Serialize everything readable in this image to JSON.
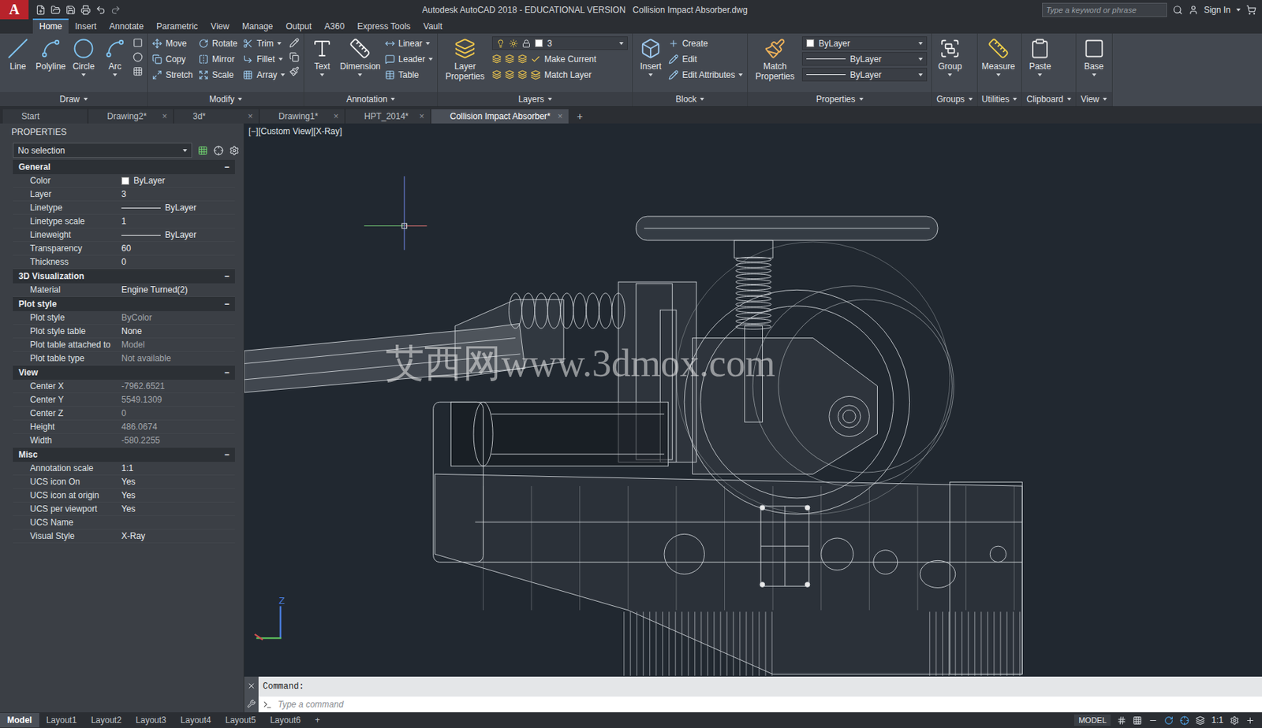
{
  "window": {
    "logo": "A",
    "app_title": "Autodesk AutoCAD 2018 - EDUCATIONAL VERSION",
    "file_name": "Collision Impact Absorber.dwg",
    "search_placeholder": "Type a keyword or phrase",
    "sign_in": "Sign In"
  },
  "ribbon_tabs": [
    {
      "label": "Home",
      "selected": true
    },
    {
      "label": "Insert",
      "selected": false
    },
    {
      "label": "Annotate",
      "selected": false
    },
    {
      "label": "Parametric",
      "selected": false
    },
    {
      "label": "View",
      "selected": false
    },
    {
      "label": "Manage",
      "selected": false
    },
    {
      "label": "Output",
      "selected": false
    },
    {
      "label": "A360",
      "selected": false
    },
    {
      "label": "Express Tools",
      "selected": false
    },
    {
      "label": "Vault",
      "selected": false
    }
  ],
  "ribbon_panels": [
    {
      "title": "Draw",
      "large": [
        {
          "label": "Line",
          "menu": false
        },
        {
          "label": "Polyline",
          "menu": false
        },
        {
          "label": "Circle",
          "menu": true
        },
        {
          "label": "Arc",
          "menu": true
        }
      ],
      "small": [],
      "dropdowns": []
    },
    {
      "title": "Modify",
      "large": [],
      "small": [
        {
          "label": "Move",
          "menu": false
        },
        {
          "label": "Rotate",
          "menu": false
        },
        {
          "label": "Trim",
          "menu": true
        },
        {
          "label": "Copy",
          "menu": false
        },
        {
          "label": "Mirror",
          "menu": false
        },
        {
          "label": "Fillet",
          "menu": true
        },
        {
          "label": "Stretch",
          "menu": false
        },
        {
          "label": "Scale",
          "menu": false
        },
        {
          "label": "Array",
          "menu": true
        }
      ],
      "dropdowns": []
    },
    {
      "title": "Annotation",
      "large": [
        {
          "label": "Text",
          "menu": true
        },
        {
          "label": "Dimension",
          "menu": true
        }
      ],
      "small": [
        {
          "label": "Linear",
          "menu": true
        },
        {
          "label": "Leader",
          "menu": true
        },
        {
          "label": "Table",
          "menu": false
        }
      ],
      "dropdowns": []
    },
    {
      "title": "Layers",
      "large": [
        {
          "label": "Layer Properties",
          "menu": false
        }
      ],
      "small": [
        {
          "label": "Make Current",
          "menu": false
        },
        {
          "label": "Match Layer",
          "menu": false
        }
      ],
      "dropdowns": [
        {
          "value": "3",
          "kind": "layer"
        }
      ]
    },
    {
      "title": "Block",
      "large": [
        {
          "label": "Insert",
          "menu": true
        }
      ],
      "small": [
        {
          "label": "Create",
          "menu": false
        },
        {
          "label": "Edit",
          "menu": false
        },
        {
          "label": "Edit Attributes",
          "menu": true
        }
      ],
      "dropdowns": []
    },
    {
      "title": "Properties",
      "large": [
        {
          "label": "Match Properties",
          "menu": false
        }
      ],
      "small": [],
      "dropdowns": [
        {
          "value": "ByLayer",
          "kind": "color"
        },
        {
          "value": "ByLayer",
          "kind": "line"
        },
        {
          "value": "ByLayer",
          "kind": "line"
        }
      ]
    },
    {
      "title": "Groups",
      "large": [
        {
          "label": "Group",
          "menu": true
        }
      ],
      "small": [],
      "dropdowns": []
    },
    {
      "title": "Utilities",
      "large": [
        {
          "label": "Measure",
          "menu": true
        }
      ],
      "small": [],
      "dropdowns": []
    },
    {
      "title": "Clipboard",
      "large": [
        {
          "label": "Paste",
          "menu": true
        }
      ],
      "small": [],
      "dropdowns": []
    },
    {
      "title": "View",
      "large": [
        {
          "label": "Base",
          "menu": true
        }
      ],
      "small": [],
      "dropdowns": []
    }
  ],
  "doc_tabs": [
    {
      "label": "Start",
      "close": "",
      "selected": false
    },
    {
      "label": "Drawing2*",
      "close": "×",
      "selected": false
    },
    {
      "label": "3d*",
      "close": "×",
      "selected": false
    },
    {
      "label": "Drawing1*",
      "close": "×",
      "selected": false
    },
    {
      "label": "HPT_2014*",
      "close": "×",
      "selected": false
    },
    {
      "label": "Collision Impact Absorber*",
      "close": "×",
      "selected": true
    }
  ],
  "new_tab": "+",
  "properties": {
    "title": "PROPERTIES",
    "selection": "No selection",
    "sections": [
      {
        "title": "General",
        "toggle": "−",
        "rows": [
          {
            "label": "Color",
            "value": "ByLayer",
            "kind": "swatch",
            "disabled": false
          },
          {
            "label": "Layer",
            "value": "3",
            "kind": "text",
            "disabled": false
          },
          {
            "label": "Linetype",
            "value": "ByLayer",
            "kind": "line",
            "disabled": false
          },
          {
            "label": "Linetype scale",
            "value": "1",
            "kind": "text",
            "disabled": false
          },
          {
            "label": "Lineweight",
            "value": "ByLayer",
            "kind": "line",
            "disabled": false
          },
          {
            "label": "Transparency",
            "value": "60",
            "kind": "text",
            "disabled": false
          },
          {
            "label": "Thickness",
            "value": "0",
            "kind": "text",
            "disabled": false
          }
        ]
      },
      {
        "title": "3D Visualization",
        "toggle": "−",
        "rows": [
          {
            "label": "Material",
            "value": "Engine Turned(2)",
            "kind": "text",
            "disabled": false
          }
        ]
      },
      {
        "title": "Plot style",
        "toggle": "−",
        "rows": [
          {
            "label": "Plot style",
            "value": "ByColor",
            "kind": "text",
            "disabled": true
          },
          {
            "label": "Plot style table",
            "value": "None",
            "kind": "text",
            "disabled": false
          },
          {
            "label": "Plot table attached to",
            "value": "Model",
            "kind": "text",
            "disabled": true
          },
          {
            "label": "Plot table type",
            "value": "Not available",
            "kind": "text",
            "disabled": true
          }
        ]
      },
      {
        "title": "View",
        "toggle": "−",
        "rows": [
          {
            "label": "Center X",
            "value": "-7962.6521",
            "kind": "text",
            "disabled": true
          },
          {
            "label": "Center Y",
            "value": "5549.1309",
            "kind": "text",
            "disabled": true
          },
          {
            "label": "Center Z",
            "value": "0",
            "kind": "text",
            "disabled": true
          },
          {
            "label": "Height",
            "value": "486.0674",
            "kind": "text",
            "disabled": true
          },
          {
            "label": "Width",
            "value": "-580.2255",
            "kind": "text",
            "disabled": true
          }
        ]
      },
      {
        "title": "Misc",
        "toggle": "−",
        "rows": [
          {
            "label": "Annotation scale",
            "value": "1:1",
            "kind": "text",
            "disabled": false
          },
          {
            "label": "UCS icon On",
            "value": "Yes",
            "kind": "text",
            "disabled": false
          },
          {
            "label": "UCS icon at origin",
            "value": "Yes",
            "kind": "text",
            "disabled": false
          },
          {
            "label": "UCS per viewport",
            "value": "Yes",
            "kind": "text",
            "disabled": false
          },
          {
            "label": "UCS Name",
            "value": "",
            "kind": "text",
            "disabled": false
          },
          {
            "label": "Visual Style",
            "value": "X-Ray",
            "kind": "text",
            "disabled": false
          }
        ]
      }
    ]
  },
  "viewport": {
    "label": "[−][Custom View][X-Ray]",
    "watermark": "艾西网www.3dmox.com",
    "ucs_label": "Z"
  },
  "command": {
    "history": "Command:",
    "placeholder": "Type a command"
  },
  "layout_tabs": [
    {
      "label": "Model",
      "selected": true
    },
    {
      "label": "Layout1",
      "selected": false
    },
    {
      "label": "Layout2",
      "selected": false
    },
    {
      "label": "Layout3",
      "selected": false
    },
    {
      "label": "Layout4",
      "selected": false
    },
    {
      "label": "Layout5",
      "selected": false
    },
    {
      "label": "Layout6",
      "selected": false
    }
  ],
  "layout_new": "+",
  "status": {
    "space": "MODEL",
    "scale": "1:1"
  }
}
